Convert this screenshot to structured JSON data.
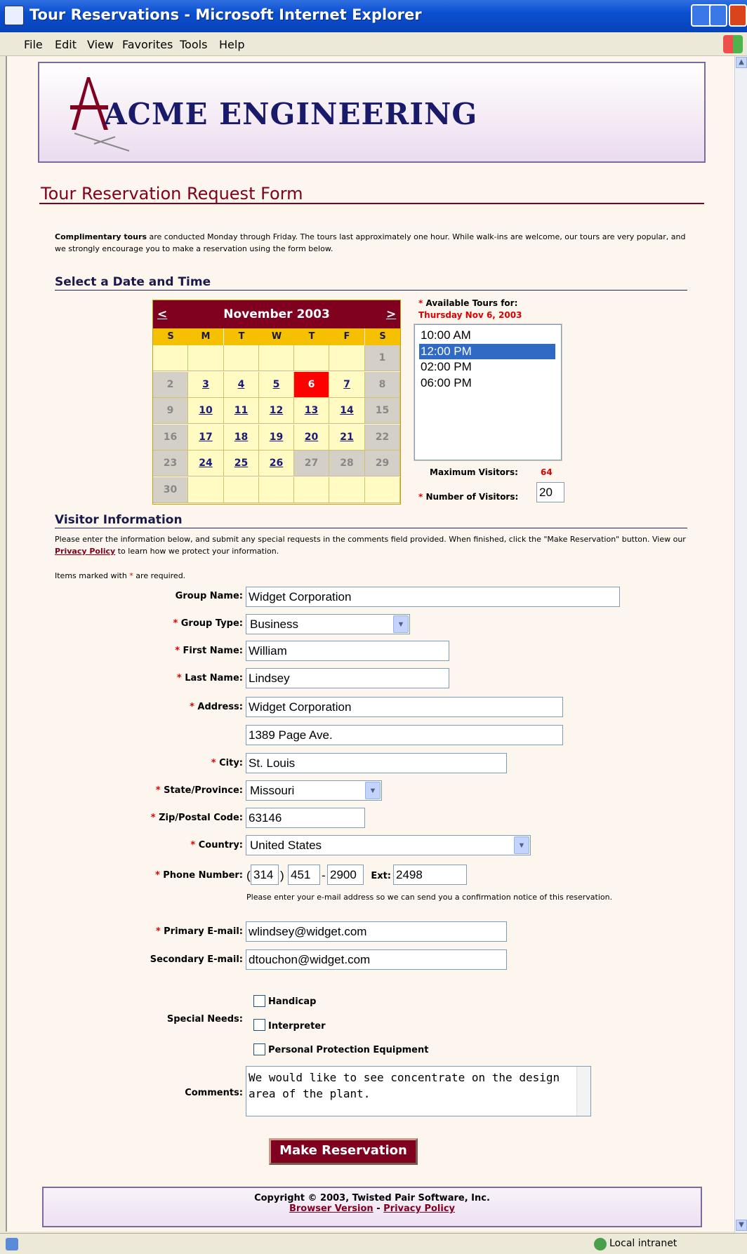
{
  "window": {
    "title": "Tour Reservations - Microsoft Internet Explorer"
  },
  "menu": [
    "File",
    "Edit",
    "View",
    "Favorites",
    "Tools",
    "Help"
  ],
  "header": {
    "logo_text": "ACME ENGINEERING"
  },
  "page_title": "Tour Reservation Request Form",
  "intro": {
    "bold": "Complimentary tours",
    "text": " are conducted Monday through Friday. The tours last approximately one hour. While walk-ins are welcome, our tours are very popular, and we strongly encourage you to make a reservation using the form below."
  },
  "section_date": "Select a Date and Time",
  "calendar": {
    "month": "November 2003",
    "prev": "<",
    "next": ">",
    "days_of_week": [
      "S",
      "M",
      "T",
      "W",
      "T",
      "F",
      "S"
    ],
    "weeks": [
      [
        {
          "d": "",
          "s": "emp"
        },
        {
          "d": "",
          "s": "emp"
        },
        {
          "d": "",
          "s": "emp"
        },
        {
          "d": "",
          "s": "emp"
        },
        {
          "d": "",
          "s": "emp"
        },
        {
          "d": "",
          "s": "emp"
        },
        {
          "d": "1",
          "s": "na"
        }
      ],
      [
        {
          "d": "2",
          "s": "na"
        },
        {
          "d": "3",
          "s": "av"
        },
        {
          "d": "4",
          "s": "av"
        },
        {
          "d": "5",
          "s": "av"
        },
        {
          "d": "6",
          "s": "sel"
        },
        {
          "d": "7",
          "s": "av"
        },
        {
          "d": "8",
          "s": "na"
        }
      ],
      [
        {
          "d": "9",
          "s": "na"
        },
        {
          "d": "10",
          "s": "av"
        },
        {
          "d": "11",
          "s": "av"
        },
        {
          "d": "12",
          "s": "av"
        },
        {
          "d": "13",
          "s": "av"
        },
        {
          "d": "14",
          "s": "av"
        },
        {
          "d": "15",
          "s": "na"
        }
      ],
      [
        {
          "d": "16",
          "s": "na"
        },
        {
          "d": "17",
          "s": "av"
        },
        {
          "d": "18",
          "s": "av"
        },
        {
          "d": "19",
          "s": "av"
        },
        {
          "d": "20",
          "s": "av"
        },
        {
          "d": "21",
          "s": "av"
        },
        {
          "d": "22",
          "s": "na"
        }
      ],
      [
        {
          "d": "23",
          "s": "na"
        },
        {
          "d": "24",
          "s": "av"
        },
        {
          "d": "25",
          "s": "av"
        },
        {
          "d": "26",
          "s": "av"
        },
        {
          "d": "27",
          "s": "na"
        },
        {
          "d": "28",
          "s": "na"
        },
        {
          "d": "29",
          "s": "na"
        }
      ],
      [
        {
          "d": "30",
          "s": "na"
        },
        {
          "d": "",
          "s": "emp"
        },
        {
          "d": "",
          "s": "emp"
        },
        {
          "d": "",
          "s": "emp"
        },
        {
          "d": "",
          "s": "emp"
        },
        {
          "d": "",
          "s": "emp"
        },
        {
          "d": "",
          "s": "emp"
        }
      ]
    ]
  },
  "tours": {
    "label": "Available Tours for:",
    "date": "Thursday Nov 6, 2003",
    "times": [
      "10:00 AM",
      "12:00 PM",
      "02:00 PM",
      "06:00 PM"
    ],
    "selected": 1,
    "max_label": "Maximum Visitors:",
    "max_value": "64",
    "visitors_label": "Number of Visitors:",
    "visitors_value": "20"
  },
  "section_visitor": "Visitor Information",
  "visitor_intro_1": "Please enter the information below, and submit any special requests in the comments field provided. When finished, click the \"Make Reservation\" button.  View our ",
  "privacy_link": "Privacy Policy",
  "visitor_intro_2": " to learn how we protect your information.",
  "required_note": {
    "pre": "Items marked with ",
    "star": "*",
    "post": " are required."
  },
  "form": {
    "group_name": {
      "label": "Group Name:",
      "value": "Widget Corporation"
    },
    "group_type": {
      "label": "Group Type:",
      "value": "Business"
    },
    "first_name": {
      "label": "First Name:",
      "value": "William"
    },
    "last_name": {
      "label": "Last Name:",
      "value": "Lindsey"
    },
    "address": {
      "label": "Address:",
      "value1": "Widget Corporation",
      "value2": "1389 Page Ave."
    },
    "city": {
      "label": "City:",
      "value": "St. Louis"
    },
    "state": {
      "label": "State/Province:",
      "value": "Missouri"
    },
    "zip": {
      "label": "Zip/Postal Code:",
      "value": "63146"
    },
    "country": {
      "label": "Country:",
      "value": "United States"
    },
    "phone": {
      "label": "Phone Number:",
      "area": "314",
      "prefix": "451",
      "line": "2900",
      "ext_label": "Ext:",
      "ext": "2498",
      "open_paren": "(",
      "close_paren": ")",
      "dash": "-"
    },
    "email_note": "Please enter your e-mail address so we can send you a confirmation notice of this reservation.",
    "primary_email": {
      "label": "Primary E-mail:",
      "value": "wlindsey@widget.com"
    },
    "secondary_email": {
      "label": "Secondary E-mail:",
      "value": "dtouchon@widget.com"
    },
    "special_needs": {
      "label": "Special Needs:",
      "options": [
        "Handicap",
        "Interpreter",
        "Personal Protection Equipment"
      ]
    },
    "comments": {
      "label": "Comments:",
      "value": "We would like to see concentrate on the design area of the plant."
    },
    "submit": "Make Reservation"
  },
  "footer": {
    "copyright": "Copyright © 2003, Twisted Pair Software, Inc.",
    "browser_link": "Browser Version",
    "sep": " - ",
    "privacy_link": "Privacy Policy"
  },
  "status": {
    "zone": "Local intranet"
  },
  "colors": {
    "accent": "#800020",
    "navy": "#1a1a4a",
    "selected_day": "#ff0000"
  }
}
